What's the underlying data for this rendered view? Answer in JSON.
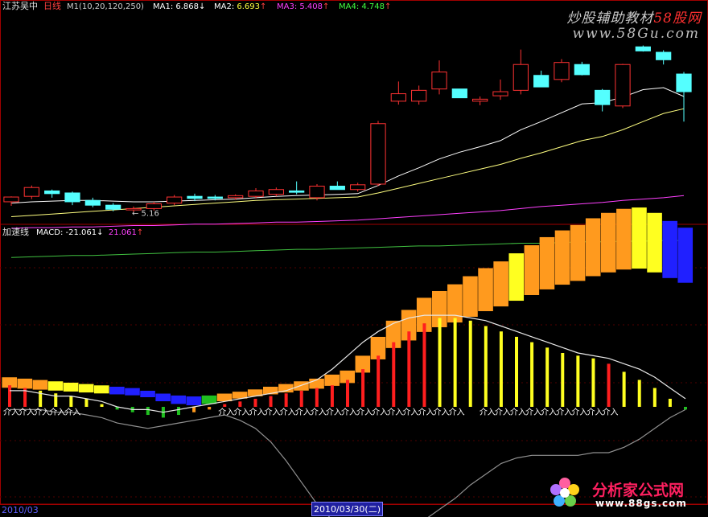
{
  "header": {
    "stock_name": "江苏吴中",
    "period": "日线",
    "params": "M1(10,20,120,250)",
    "ma": [
      {
        "label": "MA1:",
        "value": "6.868",
        "arrow": "↓",
        "color": "#ffffff"
      },
      {
        "label": "MA2:",
        "value": "6.693",
        "arrow": "↑",
        "color": "#ffff40"
      },
      {
        "label": "MA3:",
        "value": "5.408",
        "arrow": "↑",
        "color": "#ff40ff"
      },
      {
        "label": "MA4:",
        "value": "4.748",
        "arrow": "↑",
        "color": "#40ff40"
      }
    ]
  },
  "lower_header": {
    "indicator_name": "加速线",
    "macd_label": "MACD:",
    "macd_value": "-21.061",
    "macd_arrow": "↓",
    "macd_value2": "21.061",
    "macd_arrow2": "↑"
  },
  "watermark": {
    "line1_prefix": "炒股辅助教材",
    "line1_brand": "58股网",
    "line2": "www.58Gu.com"
  },
  "footer": {
    "left_date": "2010/03",
    "cursor_date": "2010/03/30(二)"
  },
  "logo": {
    "title": "分析家公式网",
    "url": "www.88gs.com"
  },
  "colors": {
    "up": "#ff3232",
    "down": "#54ffff",
    "ma1": "#ffffff",
    "ma2": "#ffff80",
    "ma3": "#ff40ff",
    "ma4": "#40c040",
    "frame": "#a00000"
  },
  "chart_data": [
    {
      "type": "candlestick",
      "title": "江苏吴中 日线",
      "min_price_label": "5.16",
      "ylim": [
        5.0,
        8.1
      ],
      "candles": [
        {
          "o": 5.32,
          "h": 5.4,
          "l": 5.26,
          "c": 5.39
        },
        {
          "o": 5.4,
          "h": 5.56,
          "l": 5.36,
          "c": 5.53
        },
        {
          "o": 5.48,
          "h": 5.5,
          "l": 5.38,
          "c": 5.44
        },
        {
          "o": 5.45,
          "h": 5.47,
          "l": 5.27,
          "c": 5.32
        },
        {
          "o": 5.34,
          "h": 5.38,
          "l": 5.24,
          "c": 5.27
        },
        {
          "o": 5.27,
          "h": 5.3,
          "l": 5.18,
          "c": 5.21
        },
        {
          "o": 5.2,
          "h": 5.25,
          "l": 5.16,
          "c": 5.22
        },
        {
          "o": 5.22,
          "h": 5.32,
          "l": 5.19,
          "c": 5.29
        },
        {
          "o": 5.3,
          "h": 5.42,
          "l": 5.27,
          "c": 5.39
        },
        {
          "o": 5.4,
          "h": 5.44,
          "l": 5.33,
          "c": 5.37
        },
        {
          "o": 5.39,
          "h": 5.42,
          "l": 5.34,
          "c": 5.37
        },
        {
          "o": 5.38,
          "h": 5.43,
          "l": 5.35,
          "c": 5.41
        },
        {
          "o": 5.4,
          "h": 5.52,
          "l": 5.37,
          "c": 5.48
        },
        {
          "o": 5.43,
          "h": 5.53,
          "l": 5.4,
          "c": 5.5
        },
        {
          "o": 5.48,
          "h": 5.62,
          "l": 5.43,
          "c": 5.46
        },
        {
          "o": 5.38,
          "h": 5.58,
          "l": 5.34,
          "c": 5.55
        },
        {
          "o": 5.55,
          "h": 5.62,
          "l": 5.5,
          "c": 5.5
        },
        {
          "o": 5.5,
          "h": 5.6,
          "l": 5.47,
          "c": 5.57
        },
        {
          "o": 5.58,
          "h": 6.51,
          "l": 5.55,
          "c": 6.47
        },
        {
          "o": 6.8,
          "h": 7.09,
          "l": 6.75,
          "c": 6.91
        },
        {
          "o": 6.8,
          "h": 7.03,
          "l": 6.75,
          "c": 6.96
        },
        {
          "o": 6.98,
          "h": 7.4,
          "l": 6.9,
          "c": 7.23
        },
        {
          "o": 6.98,
          "h": 6.96,
          "l": 6.86,
          "c": 6.85
        },
        {
          "o": 6.8,
          "h": 6.87,
          "l": 6.74,
          "c": 6.83
        },
        {
          "o": 6.88,
          "h": 7.12,
          "l": 6.82,
          "c": 6.94
        },
        {
          "o": 6.96,
          "h": 7.56,
          "l": 6.9,
          "c": 7.34
        },
        {
          "o": 7.18,
          "h": 7.25,
          "l": 7.01,
          "c": 7.01
        },
        {
          "o": 7.12,
          "h": 7.42,
          "l": 7.08,
          "c": 7.37
        },
        {
          "o": 7.34,
          "h": 7.38,
          "l": 7.18,
          "c": 7.19
        },
        {
          "o": 6.96,
          "h": 6.98,
          "l": 6.65,
          "c": 6.75
        },
        {
          "o": 6.73,
          "h": 7.35,
          "l": 6.7,
          "c": 7.34
        },
        {
          "o": 7.6,
          "h": 7.62,
          "l": 7.53,
          "c": 7.54
        },
        {
          "o": 7.52,
          "h": 7.55,
          "l": 7.34,
          "c": 7.41
        },
        {
          "o": 7.2,
          "h": 7.23,
          "l": 6.5,
          "c": 6.94
        }
      ],
      "ma_lines": [
        {
          "name": "MA1",
          "values": [
            5.3,
            5.32,
            5.33,
            5.34,
            5.34,
            5.33,
            5.32,
            5.32,
            5.33,
            5.34,
            5.35,
            5.36,
            5.38,
            5.4,
            5.41,
            5.42,
            5.43,
            5.44,
            5.56,
            5.7,
            5.82,
            5.95,
            6.05,
            6.13,
            6.22,
            6.38,
            6.5,
            6.63,
            6.76,
            6.78,
            6.86,
            6.97,
            7.0,
            6.87
          ]
        },
        {
          "name": "MA2",
          "values": [
            5.1,
            5.12,
            5.14,
            5.16,
            5.18,
            5.2,
            5.22,
            5.24,
            5.26,
            5.28,
            5.3,
            5.32,
            5.34,
            5.35,
            5.36,
            5.37,
            5.38,
            5.39,
            5.45,
            5.52,
            5.59,
            5.66,
            5.73,
            5.8,
            5.87,
            5.96,
            6.04,
            6.13,
            6.22,
            6.28,
            6.38,
            6.5,
            6.62,
            6.69
          ]
        },
        {
          "name": "MA3",
          "values": [
            4.93,
            4.94,
            4.94,
            4.95,
            4.95,
            4.96,
            4.97,
            4.97,
            4.98,
            4.99,
            4.99,
            5.0,
            5.01,
            5.02,
            5.02,
            5.03,
            5.04,
            5.05,
            5.07,
            5.09,
            5.11,
            5.13,
            5.15,
            5.17,
            5.19,
            5.22,
            5.25,
            5.27,
            5.29,
            5.31,
            5.34,
            5.36,
            5.38,
            5.41
          ]
        },
        {
          "name": "MA4",
          "values": [
            4.5,
            4.51,
            4.52,
            4.53,
            4.53,
            4.54,
            4.55,
            4.56,
            4.57,
            4.58,
            4.58,
            4.59,
            4.6,
            4.61,
            4.62,
            4.62,
            4.63,
            4.64,
            4.65,
            4.66,
            4.67,
            4.67,
            4.68,
            4.69,
            4.7,
            4.71,
            4.71,
            4.72,
            4.73,
            4.73,
            4.74,
            4.74,
            4.75,
            4.75
          ]
        }
      ]
    },
    {
      "type": "bar",
      "title": "加速线",
      "ylim": [
        -52,
        52
      ],
      "accel": [
        10,
        9,
        8,
        7,
        6,
        5,
        4,
        3,
        2,
        0,
        -3,
        -5,
        -6,
        -5,
        -3,
        -1,
        1,
        3,
        5,
        7,
        9,
        12,
        15,
        26,
        40,
        52,
        60,
        69,
        74,
        79,
        85,
        91,
        96,
        102,
        108,
        114,
        119,
        123,
        128,
        132,
        135,
        136,
        132,
        126,
        121
      ],
      "accel_colors": [
        "orange",
        "orange",
        "orange",
        "yellow",
        "yellow",
        "yellow",
        "yellow",
        "blue",
        "blue",
        "blue",
        "blue",
        "blue",
        "blue",
        "green",
        "orange",
        "orange",
        "orange",
        "orange",
        "orange",
        "orange",
        "orange",
        "orange",
        "orange",
        "orange",
        "orange",
        "orange",
        "orange",
        "orange",
        "orange",
        "orange",
        "orange",
        "orange",
        "orange",
        "yellow",
        "orange",
        "orange",
        "orange",
        "orange",
        "orange",
        "orange",
        "orange",
        "yellow",
        "yellow",
        "blue",
        "blue"
      ],
      "macd_hist": [
        8,
        7,
        6,
        5,
        4,
        3,
        1,
        -1,
        -2,
        -3,
        -4,
        -3,
        -2,
        -1,
        1,
        2,
        3,
        4,
        5,
        6,
        7,
        8,
        10,
        14,
        19,
        24,
        28,
        31,
        33,
        33,
        32,
        30,
        28,
        26,
        24,
        22,
        20,
        19,
        18,
        16,
        13,
        10,
        7,
        3,
        -1
      ],
      "hist_colors": [
        "red",
        "red",
        "yellow",
        "yellow",
        "yellow",
        "yellow",
        "yellow",
        "green",
        "green",
        "green",
        "green",
        "green",
        "orange",
        "orange",
        "red",
        "red",
        "red",
        "red",
        "red",
        "red",
        "red",
        "red",
        "red",
        "red",
        "red",
        "red",
        "red",
        "red",
        "yellow",
        "yellow",
        "yellow",
        "yellow",
        "yellow",
        "yellow",
        "yellow",
        "yellow",
        "yellow",
        "yellow",
        "yellow",
        "red",
        "yellow",
        "yellow",
        "yellow",
        "yellow",
        "green"
      ],
      "upper_line": [
        6,
        6,
        5,
        4,
        4,
        3,
        2,
        0,
        -1,
        -1,
        -2,
        -1,
        0,
        1,
        2,
        3,
        4,
        5,
        6,
        8,
        10,
        14,
        19,
        24,
        28,
        31,
        33,
        34,
        34,
        34,
        33,
        32,
        30,
        28,
        26,
        24,
        22,
        20,
        19,
        18,
        16,
        14,
        11,
        7,
        3
      ],
      "lower_line": [
        -1,
        -1,
        -1,
        -2,
        -2,
        -3,
        -4,
        -6,
        -7,
        -8,
        -7,
        -6,
        -5,
        -4,
        -3,
        -5,
        -8,
        -13,
        -20,
        -28,
        -36,
        -42,
        -46,
        -48,
        -48,
        -47,
        -45,
        -42,
        -38,
        -34,
        -29,
        -25,
        -21,
        -19,
        -18,
        -18,
        -18,
        -18,
        -17,
        -17,
        -15,
        -12,
        -8,
        -4,
        -1
      ],
      "signal_text": "介入"
    }
  ]
}
